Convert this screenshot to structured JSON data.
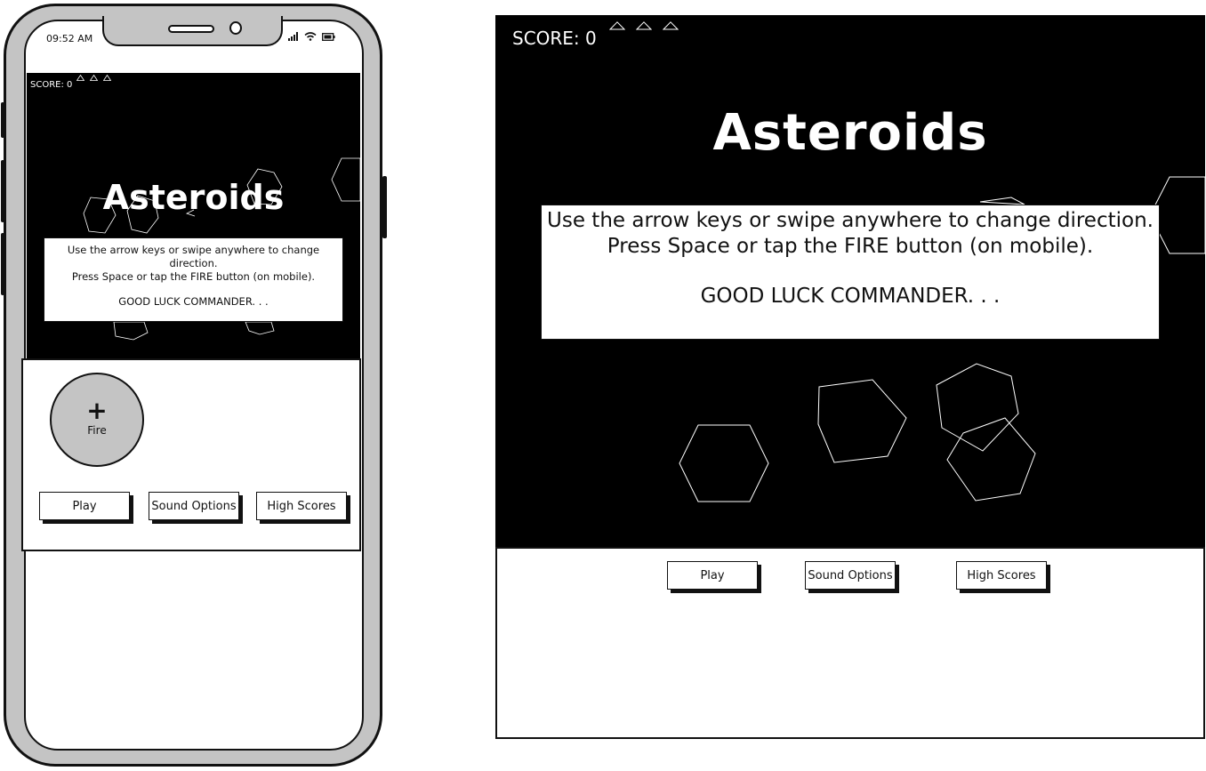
{
  "phone": {
    "status": {
      "time": "09:52 AM",
      "icons": [
        "signal-icon",
        "wifi-icon",
        "battery-icon"
      ]
    },
    "game": {
      "score": "SCORE: 0",
      "lives_icon": "ship-triangle-icon",
      "title": "Asteroids",
      "info": {
        "line1": "Use the arrow keys or swipe anywhere to change direction.",
        "line2": "Press Space or tap the FIRE button (on mobile).",
        "line3": "GOOD LUCK COMMANDER. . ."
      }
    },
    "controls": {
      "fire_icon": "plus-icon",
      "fire_label": "Fire",
      "play": "Play",
      "sound": "Sound Options",
      "scores": "High Scores"
    }
  },
  "desktop": {
    "game": {
      "score": "SCORE: 0",
      "lives_icon": "ship-triangle-icon",
      "title": "Asteroids",
      "info": {
        "line1": "Use the arrow keys or swipe anywhere to change direction.",
        "line2": "Press Space or tap the FIRE button (on mobile).",
        "line3": "GOOD LUCK COMMANDER. . ."
      }
    },
    "controls": {
      "play": "Play",
      "sound": "Sound Options",
      "scores": "High Scores"
    }
  },
  "colors": {
    "game_background": "#000000",
    "device_frame": "#c4c4c4",
    "ink": "#111111"
  }
}
